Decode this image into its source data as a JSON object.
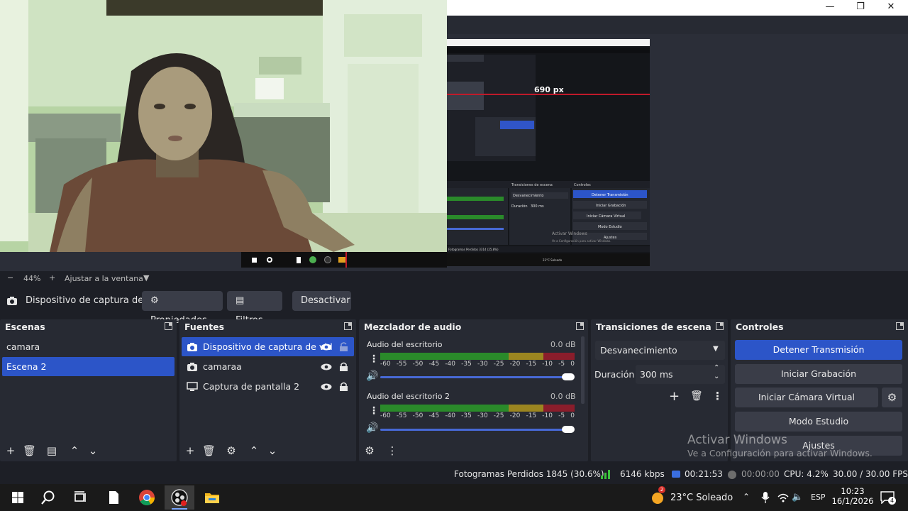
{
  "window": {
    "minimize_glyph": "—",
    "restore_glyph": "❐",
    "close_glyph": "✕"
  },
  "preview": {
    "capture_label": "690 px",
    "capture_mini": {
      "transitions": "Transiciones de escena",
      "controls": "Controles",
      "fade": "Desvanecimiento",
      "duration": "Duración",
      "duration_value": "300 ms",
      "stop": "Detener Transmisión",
      "rec": "Iniciar Grabación",
      "vcam": "Iniciar Cámara Virtual",
      "studio": "Modo Estudio",
      "settings": "Ajustes",
      "wm1": "Activar Windows",
      "wm2": "Ve a Configuración para activar Windows.",
      "status": "Fotogramas Perdidos 3314 (25.8%)",
      "weather": "23°C Soleado"
    }
  },
  "zoom": {
    "minus": "−",
    "value": "44%",
    "plus": "+",
    "fit": "Ajustar a la ventana",
    "arrow": "▼"
  },
  "context": {
    "source_name": "Dispositivo de captura de v",
    "properties": "Propiedades",
    "filters": "Filtros",
    "deactivate": "Desactivar"
  },
  "scenes": {
    "title": "Escenas",
    "items": [
      "camara",
      "Escena 2"
    ],
    "selected_index": 1
  },
  "sources": {
    "title": "Fuentes",
    "items": [
      {
        "label": "Dispositivo de captura de vid",
        "icon": "camera-icon",
        "selected": true
      },
      {
        "label": "camaraa",
        "icon": "camera-icon",
        "selected": false
      },
      {
        "label": "Captura de pantalla 2",
        "icon": "monitor-icon",
        "selected": false
      }
    ]
  },
  "mixer": {
    "title": "Mezclador de audio",
    "channels": [
      {
        "name": "Audio del escritorio",
        "db": "0.0 dB",
        "volume": 1.0
      },
      {
        "name": "Audio del escritorio 2",
        "db": "0.0 dB",
        "volume": 1.0
      }
    ],
    "ticks": [
      "-60",
      "-55",
      "-50",
      "-45",
      "-40",
      "-35",
      "-30",
      "-25",
      "-20",
      "-15",
      "-10",
      "-5",
      "0"
    ]
  },
  "transitions": {
    "title": "Transiciones de escena",
    "selected": "Desvanecimiento",
    "duration_label": "Duración",
    "duration_value": "300 ms"
  },
  "controls": {
    "title": "Controles",
    "stop_stream": "Detener Transmisión",
    "start_rec": "Iniciar Grabación",
    "start_vcam": "Iniciar Cámara Virtual",
    "studio_mode": "Modo Estudio",
    "settings": "Ajustes"
  },
  "status": {
    "dropped": "Fotogramas Perdidos 1845 (30.6%)",
    "bitrate": "6146 kbps",
    "stream_time": "00:21:53",
    "rec_time": "00:00:00",
    "cpu": "CPU: 4.2%",
    "fps": "30.00 / 30.00 FPS"
  },
  "watermark": {
    "line1": "Activar Windows",
    "line2": "Ve a Configuración para activar Windows."
  },
  "taskbar": {
    "weather": "23°C  Soleado",
    "weather_badge": "2",
    "lang": "ESP",
    "time": "10:23",
    "date": "16/1/2026",
    "notif_count": "4"
  },
  "colors": {
    "accent": "#2c55c8",
    "panel": "#272a33",
    "background": "#1d1f26",
    "meter_green": "#2a8a2a",
    "meter_yellow": "#9b8520",
    "meter_red": "#8a1d2b"
  }
}
